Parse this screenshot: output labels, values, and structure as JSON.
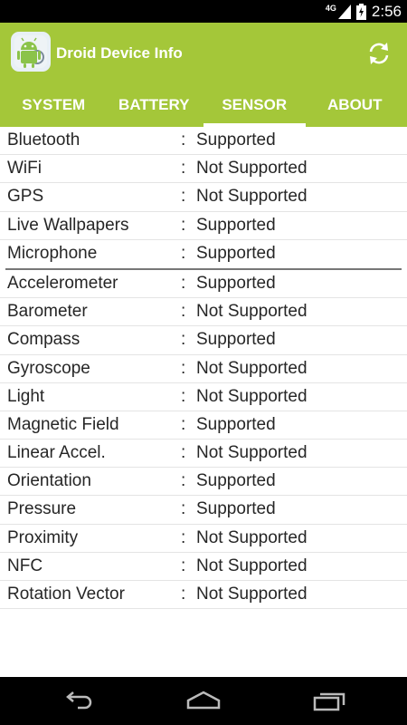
{
  "status": {
    "network": "4G",
    "time": "2:56"
  },
  "app": {
    "title": "Droid Device Info"
  },
  "tabs": [
    {
      "label": "SYSTEM",
      "active": false
    },
    {
      "label": "BATTERY",
      "active": false
    },
    {
      "label": "SENSOR",
      "active": true
    },
    {
      "label": "ABOUT",
      "active": false
    }
  ],
  "rows_group1": [
    {
      "label": "Bluetooth",
      "sep": ":",
      "value": "Supported"
    },
    {
      "label": "WiFi",
      "sep": ":",
      "value": "Not Supported"
    },
    {
      "label": "GPS",
      "sep": ":",
      "value": "Not Supported"
    },
    {
      "label": "Live Wallpapers",
      "sep": ":",
      "value": "Supported"
    },
    {
      "label": "Microphone",
      "sep": ":",
      "value": "Supported"
    }
  ],
  "rows_group2": [
    {
      "label": "Accelerometer",
      "sep": ":",
      "value": "Supported"
    },
    {
      "label": "Barometer",
      "sep": ":",
      "value": "Not Supported"
    },
    {
      "label": "Compass",
      "sep": ":",
      "value": "Supported"
    },
    {
      "label": "Gyroscope",
      "sep": ":",
      "value": "Not Supported"
    },
    {
      "label": "Light",
      "sep": ":",
      "value": "Not Supported"
    },
    {
      "label": "Magnetic Field",
      "sep": ":",
      "value": "Supported"
    },
    {
      "label": "Linear Accel.",
      "sep": ":",
      "value": "Not Supported"
    },
    {
      "label": "Orientation",
      "sep": ":",
      "value": "Supported"
    },
    {
      "label": "Pressure",
      "sep": ":",
      "value": "Supported"
    },
    {
      "label": "Proximity",
      "sep": ":",
      "value": "Not Supported"
    },
    {
      "label": "NFC",
      "sep": ":",
      "value": "Not Supported"
    },
    {
      "label": "Rotation Vector",
      "sep": ":",
      "value": "Not Supported"
    }
  ],
  "colors": {
    "accent": "#a4c739",
    "text": "#262626",
    "divider": "#777777"
  },
  "icons": {
    "app": "android-app-icon",
    "refresh": "refresh-icon",
    "back": "back-icon",
    "home": "home-icon",
    "recents": "recents-icon"
  }
}
